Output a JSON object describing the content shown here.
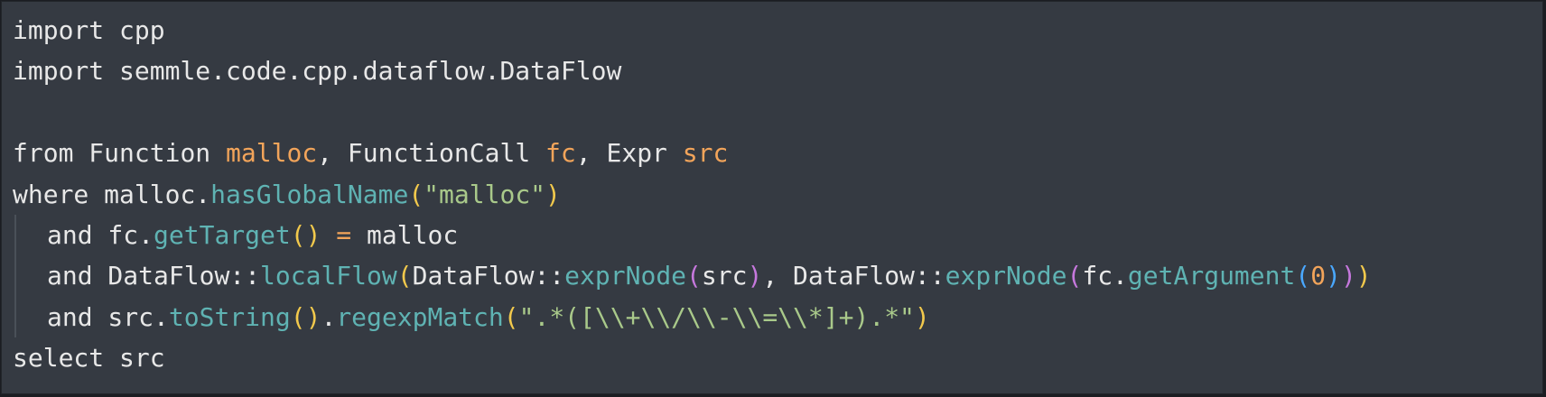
{
  "code_lines": [
    {
      "indent": false,
      "tokens": [
        {
          "t": "import",
          "c": "kw"
        },
        {
          "t": " cpp",
          "c": "plain"
        }
      ]
    },
    {
      "indent": false,
      "tokens": [
        {
          "t": "import",
          "c": "kw"
        },
        {
          "t": " semmle.code.cpp.dataflow.DataFlow",
          "c": "plain"
        }
      ]
    },
    {
      "indent": false,
      "tokens": []
    },
    {
      "indent": false,
      "tokens": [
        {
          "t": "from",
          "c": "kw"
        },
        {
          "t": " Function ",
          "c": "ty"
        },
        {
          "t": "malloc",
          "c": "var"
        },
        {
          "t": ", FunctionCall ",
          "c": "plain"
        },
        {
          "t": "fc",
          "c": "var"
        },
        {
          "t": ", Expr ",
          "c": "plain"
        },
        {
          "t": "src",
          "c": "var"
        }
      ]
    },
    {
      "indent": false,
      "tokens": [
        {
          "t": "where",
          "c": "kw"
        },
        {
          "t": " malloc.",
          "c": "plain"
        },
        {
          "t": "hasGlobalName",
          "c": "fn"
        },
        {
          "t": "(",
          "c": "p1"
        },
        {
          "t": "\"malloc\"",
          "c": "str"
        },
        {
          "t": ")",
          "c": "p1"
        }
      ]
    },
    {
      "indent": true,
      "tokens": [
        {
          "t": "and",
          "c": "kw"
        },
        {
          "t": " fc.",
          "c": "plain"
        },
        {
          "t": "getTarget",
          "c": "fn"
        },
        {
          "t": "()",
          "c": "p1"
        },
        {
          "t": " = ",
          "c": "op"
        },
        {
          "t": "malloc",
          "c": "plain"
        }
      ]
    },
    {
      "indent": true,
      "tokens": [
        {
          "t": "and",
          "c": "kw"
        },
        {
          "t": " DataFlow::",
          "c": "plain"
        },
        {
          "t": "localFlow",
          "c": "fn"
        },
        {
          "t": "(",
          "c": "p1"
        },
        {
          "t": "DataFlow::",
          "c": "plain"
        },
        {
          "t": "exprNode",
          "c": "fn"
        },
        {
          "t": "(",
          "c": "p2"
        },
        {
          "t": "src",
          "c": "plain"
        },
        {
          "t": ")",
          "c": "p2"
        },
        {
          "t": ", DataFlow::",
          "c": "plain"
        },
        {
          "t": "exprNode",
          "c": "fn"
        },
        {
          "t": "(",
          "c": "p2"
        },
        {
          "t": "fc.",
          "c": "plain"
        },
        {
          "t": "getArgument",
          "c": "fn"
        },
        {
          "t": "(",
          "c": "p3"
        },
        {
          "t": "0",
          "c": "num"
        },
        {
          "t": ")",
          "c": "p3"
        },
        {
          "t": ")",
          "c": "p2"
        },
        {
          "t": ")",
          "c": "p1"
        }
      ]
    },
    {
      "indent": true,
      "tokens": [
        {
          "t": "and",
          "c": "kw"
        },
        {
          "t": " src.",
          "c": "plain"
        },
        {
          "t": "toString",
          "c": "fn"
        },
        {
          "t": "()",
          "c": "p1"
        },
        {
          "t": ".",
          "c": "plain"
        },
        {
          "t": "regexpMatch",
          "c": "fn"
        },
        {
          "t": "(",
          "c": "p1"
        },
        {
          "t": "\".*([\\\\+\\\\/\\\\-\\\\=\\\\*]+).*\"",
          "c": "str"
        },
        {
          "t": ")",
          "c": "p1"
        }
      ]
    },
    {
      "indent": false,
      "tokens": [
        {
          "t": "select",
          "c": "kw"
        },
        {
          "t": " src",
          "c": "plain"
        }
      ]
    }
  ]
}
